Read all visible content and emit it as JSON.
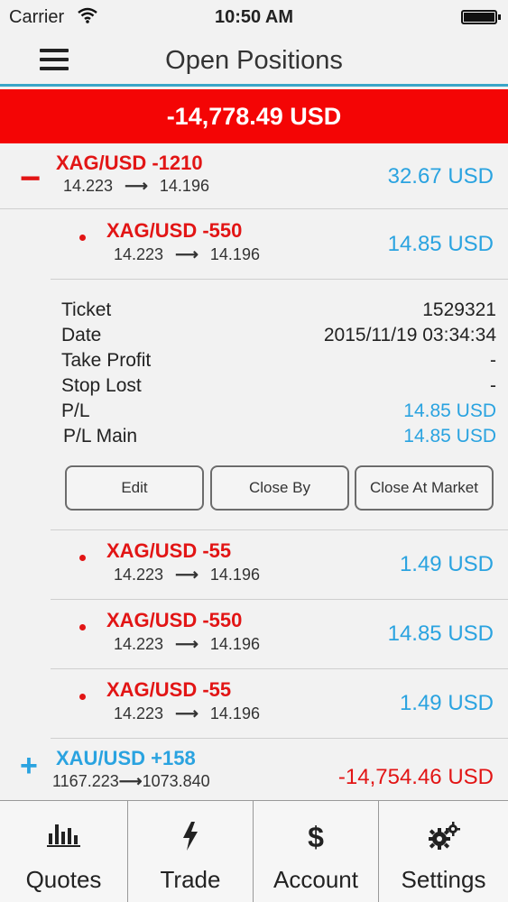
{
  "status_bar": {
    "carrier": "Carrier",
    "time": "10:50 AM"
  },
  "header": {
    "title": "Open Positions"
  },
  "total": {
    "value": "-14,778.49 USD"
  },
  "groups": [
    {
      "symbol": "XAG/USD -1210",
      "open_price": "14.223",
      "arrow": "⟶",
      "current_price": "14.196",
      "pl": "32.67 USD",
      "toggle": "−"
    },
    {
      "symbol": "XAU/USD +158",
      "open_price": "1167.223",
      "arrow": "⟶",
      "current_price": "1073.840",
      "pl": "-14,754.46 USD",
      "toggle": "+"
    }
  ],
  "trades": [
    {
      "symbol": "XAG/USD -550",
      "open_price": "14.223",
      "arrow": "⟶",
      "current_price": "14.196",
      "pl": "14.85 USD"
    },
    {
      "symbol": "XAG/USD -55",
      "open_price": "14.223",
      "arrow": "⟶",
      "current_price": "14.196",
      "pl": "1.49 USD"
    },
    {
      "symbol": "XAG/USD -550",
      "open_price": "14.223",
      "arrow": "⟶",
      "current_price": "14.196",
      "pl": "14.85 USD"
    },
    {
      "symbol": "XAG/USD -55",
      "open_price": "14.223",
      "arrow": "⟶",
      "current_price": "14.196",
      "pl": "1.49 USD"
    }
  ],
  "details": {
    "rows": [
      {
        "key": "Ticket",
        "value": "1529321"
      },
      {
        "key": "Date",
        "value": "2015/11/19 03:34:34"
      },
      {
        "key": "Take Profit",
        "value": "-"
      },
      {
        "key": "Stop Lost",
        "value": "-"
      },
      {
        "key": "P/L",
        "value": "14.85 USD"
      },
      {
        "key": "P/L Main",
        "value": "14.85 USD"
      }
    ],
    "buttons": {
      "edit": "Edit",
      "close_by": "Close By",
      "close_at_market": "Close At Market"
    }
  },
  "tabs": [
    {
      "label": "Quotes",
      "icon": "bar-chart-icon"
    },
    {
      "label": "Trade",
      "icon": "lightning-icon"
    },
    {
      "label": "Account",
      "icon": "dollar-icon",
      "glyph": "$"
    },
    {
      "label": "Settings",
      "icon": "gears-icon"
    }
  ],
  "colors": {
    "accent_blue": "#2aa3e0",
    "loss_red": "#f40505",
    "symbol_red": "#e21515",
    "header_line": "#3aa6c8"
  }
}
